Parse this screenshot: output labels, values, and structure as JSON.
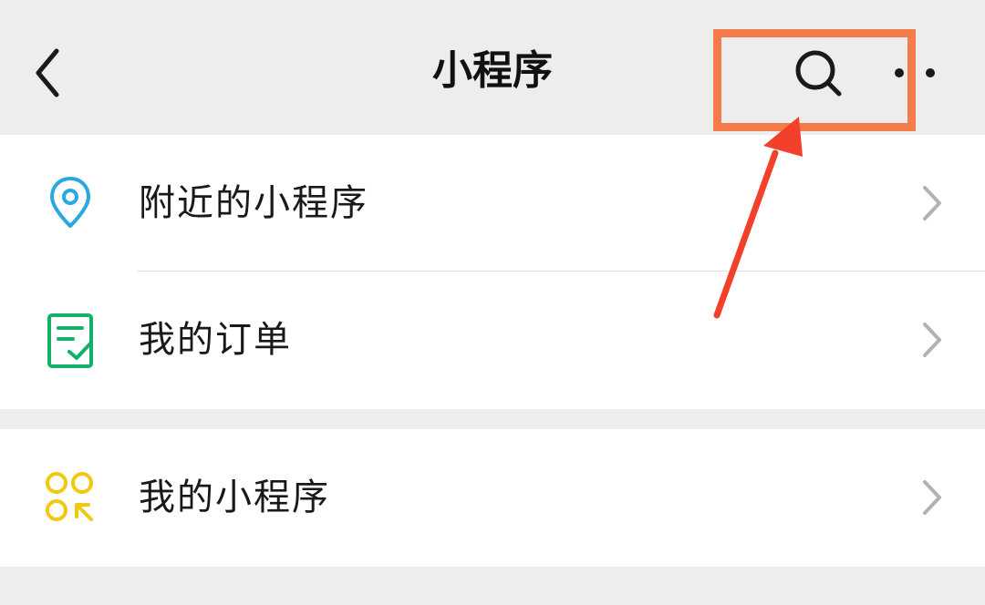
{
  "header": {
    "title": "小程序"
  },
  "colors": {
    "background": "#ededed",
    "highlight": "#f47c4b",
    "arrow": "#f2402a",
    "location_icon": "#2aa8df",
    "order_icon": "#13b068",
    "mini_program_icon": "#f2c811"
  },
  "menu": {
    "items": [
      {
        "label": "附近的小程序",
        "icon": "location-pin-icon"
      },
      {
        "label": "我的订单",
        "icon": "order-checklist-icon"
      },
      {
        "label": "我的小程序",
        "icon": "mini-programs-icon"
      }
    ]
  }
}
